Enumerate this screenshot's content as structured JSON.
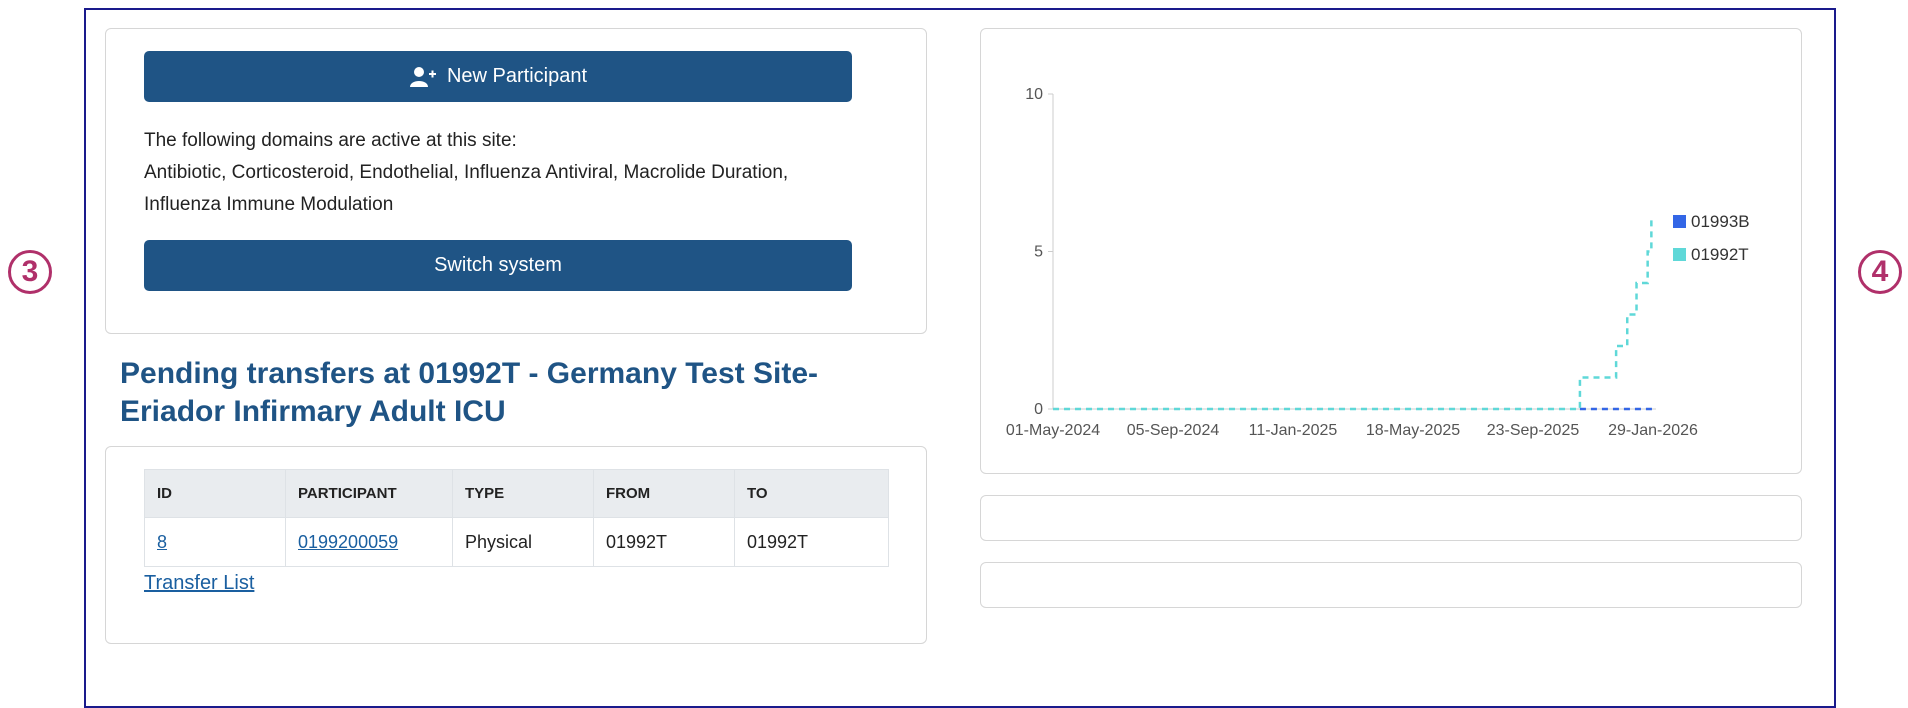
{
  "markers": {
    "left": "3",
    "right": "4"
  },
  "participant_card": {
    "new_participant_label": "New Participant",
    "domains_intro": "The following domains are active at this site:",
    "domains_line1": "Antibiotic, Corticosteroid, Endothelial, Influenza Antiviral, Macrolide Duration,",
    "domains_line2": "Influenza Immune Modulation",
    "switch_system_label": "Switch system"
  },
  "transfers": {
    "heading_line1": "Pending transfers at 01992T - Germany Test Site-",
    "heading_line2": "Eriador Infirmary Adult ICU",
    "columns": [
      "ID",
      "PARTICIPANT",
      "TYPE",
      "FROM",
      "TO"
    ],
    "rows": [
      {
        "id": "8",
        "participant": "0199200059",
        "type": "Physical",
        "from": "01992T",
        "to": "01992T"
      }
    ],
    "transfer_list_label": "Transfer List"
  },
  "colors": {
    "primary": "#1f5485",
    "series_01993B": "#3366e6",
    "series_01992T": "#5fd8d8",
    "marker": "#b0306a"
  },
  "chart_data": {
    "type": "line",
    "title": "",
    "xlabel": "",
    "ylabel": "",
    "ylim": [
      0,
      10
    ],
    "yticks": [
      0,
      5,
      10
    ],
    "xticks": [
      "01-May-2024",
      "05-Sep-2024",
      "11-Jan-2025",
      "18-May-2025",
      "23-Sep-2025",
      "29-Jan-2026"
    ],
    "xlim": [
      "2024-05-01",
      "2026-02-10"
    ],
    "legend_position": "right",
    "series": [
      {
        "name": "01993B",
        "color": "#3366e6",
        "style": "dashed-step",
        "x": [
          "2025-11-20",
          "2026-02-10"
        ],
        "values": [
          0,
          0
        ]
      },
      {
        "name": "01992T",
        "color": "#5fd8d8",
        "style": "dashed-step",
        "x": [
          "2024-05-01",
          "2025-11-20",
          "2025-12-29",
          "2026-01-10",
          "2026-01-20",
          "2026-02-01",
          "2026-02-05"
        ],
        "values": [
          0,
          1,
          2,
          3,
          4,
          5,
          6
        ]
      }
    ]
  }
}
